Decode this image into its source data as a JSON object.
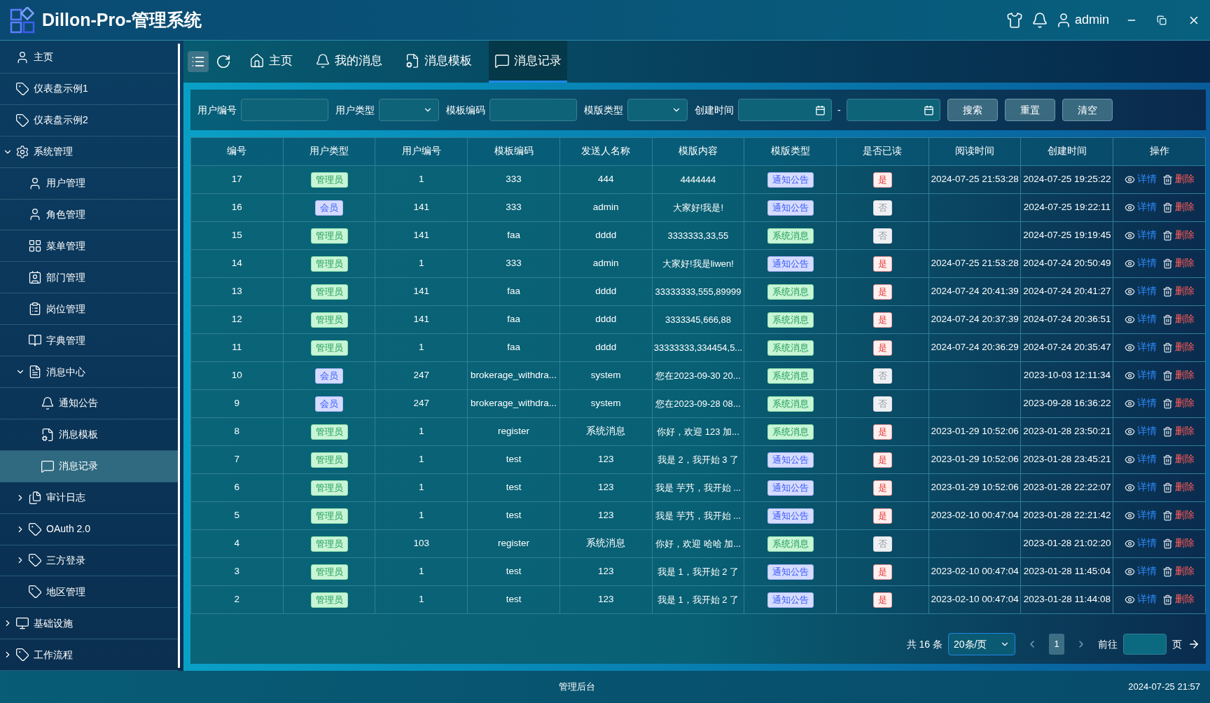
{
  "app": {
    "title": "Dillon-Pro-管理系统",
    "user": "admin"
  },
  "sidebar": {
    "items": [
      {
        "label": "主页",
        "selected": false
      },
      {
        "label": "仪表盘示例1",
        "selected": false
      },
      {
        "label": "仪表盘示例2",
        "selected": false
      },
      {
        "label": "系统管理",
        "selected": false,
        "expanded": true,
        "children": [
          {
            "label": "用户管理",
            "selected": false
          },
          {
            "label": "角色管理",
            "selected": false
          },
          {
            "label": "菜单管理",
            "selected": false
          },
          {
            "label": "部门管理",
            "selected": false
          },
          {
            "label": "岗位管理",
            "selected": false
          },
          {
            "label": "字典管理",
            "selected": false
          },
          {
            "label": "消息中心",
            "selected": false,
            "expanded": true,
            "children": [
              {
                "label": "通知公告",
                "selected": false
              },
              {
                "label": "消息模板",
                "selected": false
              },
              {
                "label": "消息记录",
                "selected": true
              }
            ]
          },
          {
            "label": "审计日志",
            "selected": false,
            "expanded": false
          },
          {
            "label": "OAuth 2.0",
            "selected": false,
            "expanded": false
          },
          {
            "label": "三方登录",
            "selected": false,
            "expanded": false
          },
          {
            "label": "地区管理",
            "selected": false
          }
        ]
      },
      {
        "label": "基础设施",
        "selected": false,
        "expanded": false
      },
      {
        "label": "工作流程",
        "selected": false,
        "expanded": false
      }
    ]
  },
  "tabs": [
    {
      "label": "主页",
      "selected": false
    },
    {
      "label": "我的消息",
      "selected": false
    },
    {
      "label": "消息模板",
      "selected": false
    },
    {
      "label": "消息记录",
      "selected": true
    }
  ],
  "filters": [
    {
      "label": "用户编号",
      "kind": "input"
    },
    {
      "label": "用户类型",
      "kind": "select"
    },
    {
      "label": "模板编码",
      "kind": "input"
    },
    {
      "label": "模版类型",
      "kind": "select"
    },
    {
      "label": "创建时间",
      "kind": "daterange",
      "separator": "-"
    }
  ],
  "filter_buttons": [
    "搜索",
    "重置",
    "清空"
  ],
  "table": {
    "columns": [
      "编号",
      "用户类型",
      "用户编号",
      "模板编码",
      "发送人名称",
      "模版内容",
      "模版类型",
      "是否已读",
      "阅读时间",
      "创建时间",
      "操作"
    ],
    "rows": [
      {
        "id": "17",
        "user_type": {
          "label": "管理员",
          "kind": "admin"
        },
        "user_id": "1",
        "template_code": "333",
        "sender": "444",
        "content": "4444444",
        "template_type": {
          "label": "通知公告",
          "kind": "notice"
        },
        "read": {
          "label": "是",
          "kind": "yes"
        },
        "read_time": "2024-07-25 21:53:28",
        "created": "2024-07-25 19:25:22",
        "actions": [
          "详情",
          "删除"
        ]
      },
      {
        "id": "16",
        "user_type": {
          "label": "会员",
          "kind": "member"
        },
        "user_id": "141",
        "template_code": "333",
        "sender": "admin",
        "content": "大家好!我是!",
        "template_type": {
          "label": "通知公告",
          "kind": "notice"
        },
        "read": {
          "label": "否",
          "kind": "no"
        },
        "created": "2024-07-25 19:22:11",
        "actions": [
          "详情",
          "删除"
        ]
      },
      {
        "id": "15",
        "user_type": {
          "label": "管理员",
          "kind": "admin"
        },
        "user_id": "141",
        "template_code": "faa",
        "sender": "dddd",
        "content": "3333333,33,55",
        "template_type": {
          "label": "系统消息",
          "kind": "system"
        },
        "read": {
          "label": "否",
          "kind": "no"
        },
        "created": "2024-07-25 19:19:45",
        "actions": [
          "详情",
          "删除"
        ]
      },
      {
        "id": "14",
        "user_type": {
          "label": "管理员",
          "kind": "admin"
        },
        "user_id": "1",
        "template_code": "333",
        "sender": "admin",
        "content": "大家好!我是liwen!",
        "template_type": {
          "label": "通知公告",
          "kind": "notice"
        },
        "read": {
          "label": "是",
          "kind": "yes"
        },
        "read_time": "2024-07-25 21:53:28",
        "created": "2024-07-24 20:50:49",
        "actions": [
          "详情",
          "删除"
        ]
      },
      {
        "id": "13",
        "user_type": {
          "label": "管理员",
          "kind": "admin"
        },
        "user_id": "141",
        "template_code": "faa",
        "sender": "dddd",
        "content": "33333333,555,89999",
        "template_type": {
          "label": "系统消息",
          "kind": "system"
        },
        "read": {
          "label": "是",
          "kind": "yes"
        },
        "read_time": "2024-07-24 20:41:39",
        "created": "2024-07-24 20:41:27",
        "actions": [
          "详情",
          "删除"
        ]
      },
      {
        "id": "12",
        "user_type": {
          "label": "管理员",
          "kind": "admin"
        },
        "user_id": "141",
        "template_code": "faa",
        "sender": "dddd",
        "content": "3333345,666,88",
        "template_type": {
          "label": "系统消息",
          "kind": "system"
        },
        "read": {
          "label": "是",
          "kind": "yes"
        },
        "read_time": "2024-07-24 20:37:39",
        "created": "2024-07-24 20:36:51",
        "actions": [
          "详情",
          "删除"
        ]
      },
      {
        "id": "11",
        "user_type": {
          "label": "管理员",
          "kind": "admin"
        },
        "user_id": "1",
        "template_code": "faa",
        "sender": "dddd",
        "content": "33333333,334454,5...",
        "template_type": {
          "label": "系统消息",
          "kind": "system"
        },
        "read": {
          "label": "是",
          "kind": "yes"
        },
        "read_time": "2024-07-24 20:36:29",
        "created": "2024-07-24 20:35:47",
        "actions": [
          "详情",
          "删除"
        ]
      },
      {
        "id": "10",
        "user_type": {
          "label": "会员",
          "kind": "member"
        },
        "user_id": "247",
        "template_code": "brokerage_withdra...",
        "sender": "system",
        "content": "您在2023-09-30 20...",
        "template_type": {
          "label": "系统消息",
          "kind": "system"
        },
        "read": {
          "label": "否",
          "kind": "no"
        },
        "created": "2023-10-03 12:11:34",
        "actions": [
          "详情",
          "删除"
        ]
      },
      {
        "id": "9",
        "user_type": {
          "label": "会员",
          "kind": "member"
        },
        "user_id": "247",
        "template_code": "brokerage_withdra...",
        "sender": "system",
        "content": "您在2023-09-28 08...",
        "template_type": {
          "label": "系统消息",
          "kind": "system"
        },
        "read": {
          "label": "否",
          "kind": "no"
        },
        "created": "2023-09-28 16:36:22",
        "actions": [
          "详情",
          "删除"
        ]
      },
      {
        "id": "8",
        "user_type": {
          "label": "管理员",
          "kind": "admin"
        },
        "user_id": "1",
        "template_code": "register",
        "sender": "系统消息",
        "content": "你好，欢迎 123 加...",
        "template_type": {
          "label": "系统消息",
          "kind": "system"
        },
        "read": {
          "label": "是",
          "kind": "yes"
        },
        "read_time": "2023-01-29 10:52:06",
        "created": "2023-01-28 23:50:21",
        "actions": [
          "详情",
          "删除"
        ]
      },
      {
        "id": "7",
        "user_type": {
          "label": "管理员",
          "kind": "admin"
        },
        "user_id": "1",
        "template_code": "test",
        "sender": "123",
        "content": "我是 2，我开始 3 了",
        "template_type": {
          "label": "通知公告",
          "kind": "notice"
        },
        "read": {
          "label": "是",
          "kind": "yes"
        },
        "read_time": "2023-01-29 10:52:06",
        "created": "2023-01-28 23:45:21",
        "actions": [
          "详情",
          "删除"
        ]
      },
      {
        "id": "6",
        "user_type": {
          "label": "管理员",
          "kind": "admin"
        },
        "user_id": "1",
        "template_code": "test",
        "sender": "123",
        "content": "我是 芋艿，我开始 ...",
        "template_type": {
          "label": "通知公告",
          "kind": "notice"
        },
        "read": {
          "label": "是",
          "kind": "yes"
        },
        "read_time": "2023-01-29 10:52:06",
        "created": "2023-01-28 22:22:07",
        "actions": [
          "详情",
          "删除"
        ]
      },
      {
        "id": "5",
        "user_type": {
          "label": "管理员",
          "kind": "admin"
        },
        "user_id": "1",
        "template_code": "test",
        "sender": "123",
        "content": "我是 芋艿，我开始 ...",
        "template_type": {
          "label": "通知公告",
          "kind": "notice"
        },
        "read": {
          "label": "是",
          "kind": "yes"
        },
        "read_time": "2023-02-10 00:47:04",
        "created": "2023-01-28 22:21:42",
        "actions": [
          "详情",
          "删除"
        ]
      },
      {
        "id": "4",
        "user_type": {
          "label": "管理员",
          "kind": "admin"
        },
        "user_id": "103",
        "template_code": "register",
        "sender": "系统消息",
        "content": "你好，欢迎 哈哈 加...",
        "template_type": {
          "label": "系统消息",
          "kind": "system"
        },
        "read": {
          "label": "否",
          "kind": "no"
        },
        "created": "2023-01-28 21:02:20",
        "actions": [
          "详情",
          "删除"
        ]
      },
      {
        "id": "3",
        "user_type": {
          "label": "管理员",
          "kind": "admin"
        },
        "user_id": "1",
        "template_code": "test",
        "sender": "123",
        "content": "我是 1，我开始 2 了",
        "template_type": {
          "label": "通知公告",
          "kind": "notice"
        },
        "read": {
          "label": "是",
          "kind": "yes"
        },
        "read_time": "2023-02-10 00:47:04",
        "created": "2023-01-28 11:45:04",
        "actions": [
          "详情",
          "删除"
        ]
      },
      {
        "id": "2",
        "user_type": {
          "label": "管理员",
          "kind": "admin"
        },
        "user_id": "1",
        "template_code": "test",
        "sender": "123",
        "content": "我是 1，我开始 2 了",
        "template_type": {
          "label": "通知公告",
          "kind": "notice"
        },
        "read": {
          "label": "是",
          "kind": "yes"
        },
        "read_time": "2023-02-10 00:47:04",
        "created": "2023-01-28 11:44:08",
        "actions": [
          "详情",
          "删除"
        ]
      }
    ]
  },
  "pagination": {
    "total": "共 16 条",
    "page_size": "20条/页",
    "pages": [
      {
        "label": "1",
        "selected": true
      }
    ],
    "goto_label": "前往",
    "goto_suffix": "页"
  },
  "status_bar": {
    "center": "管理后台",
    "time": "2024-07-25 21:57"
  }
}
